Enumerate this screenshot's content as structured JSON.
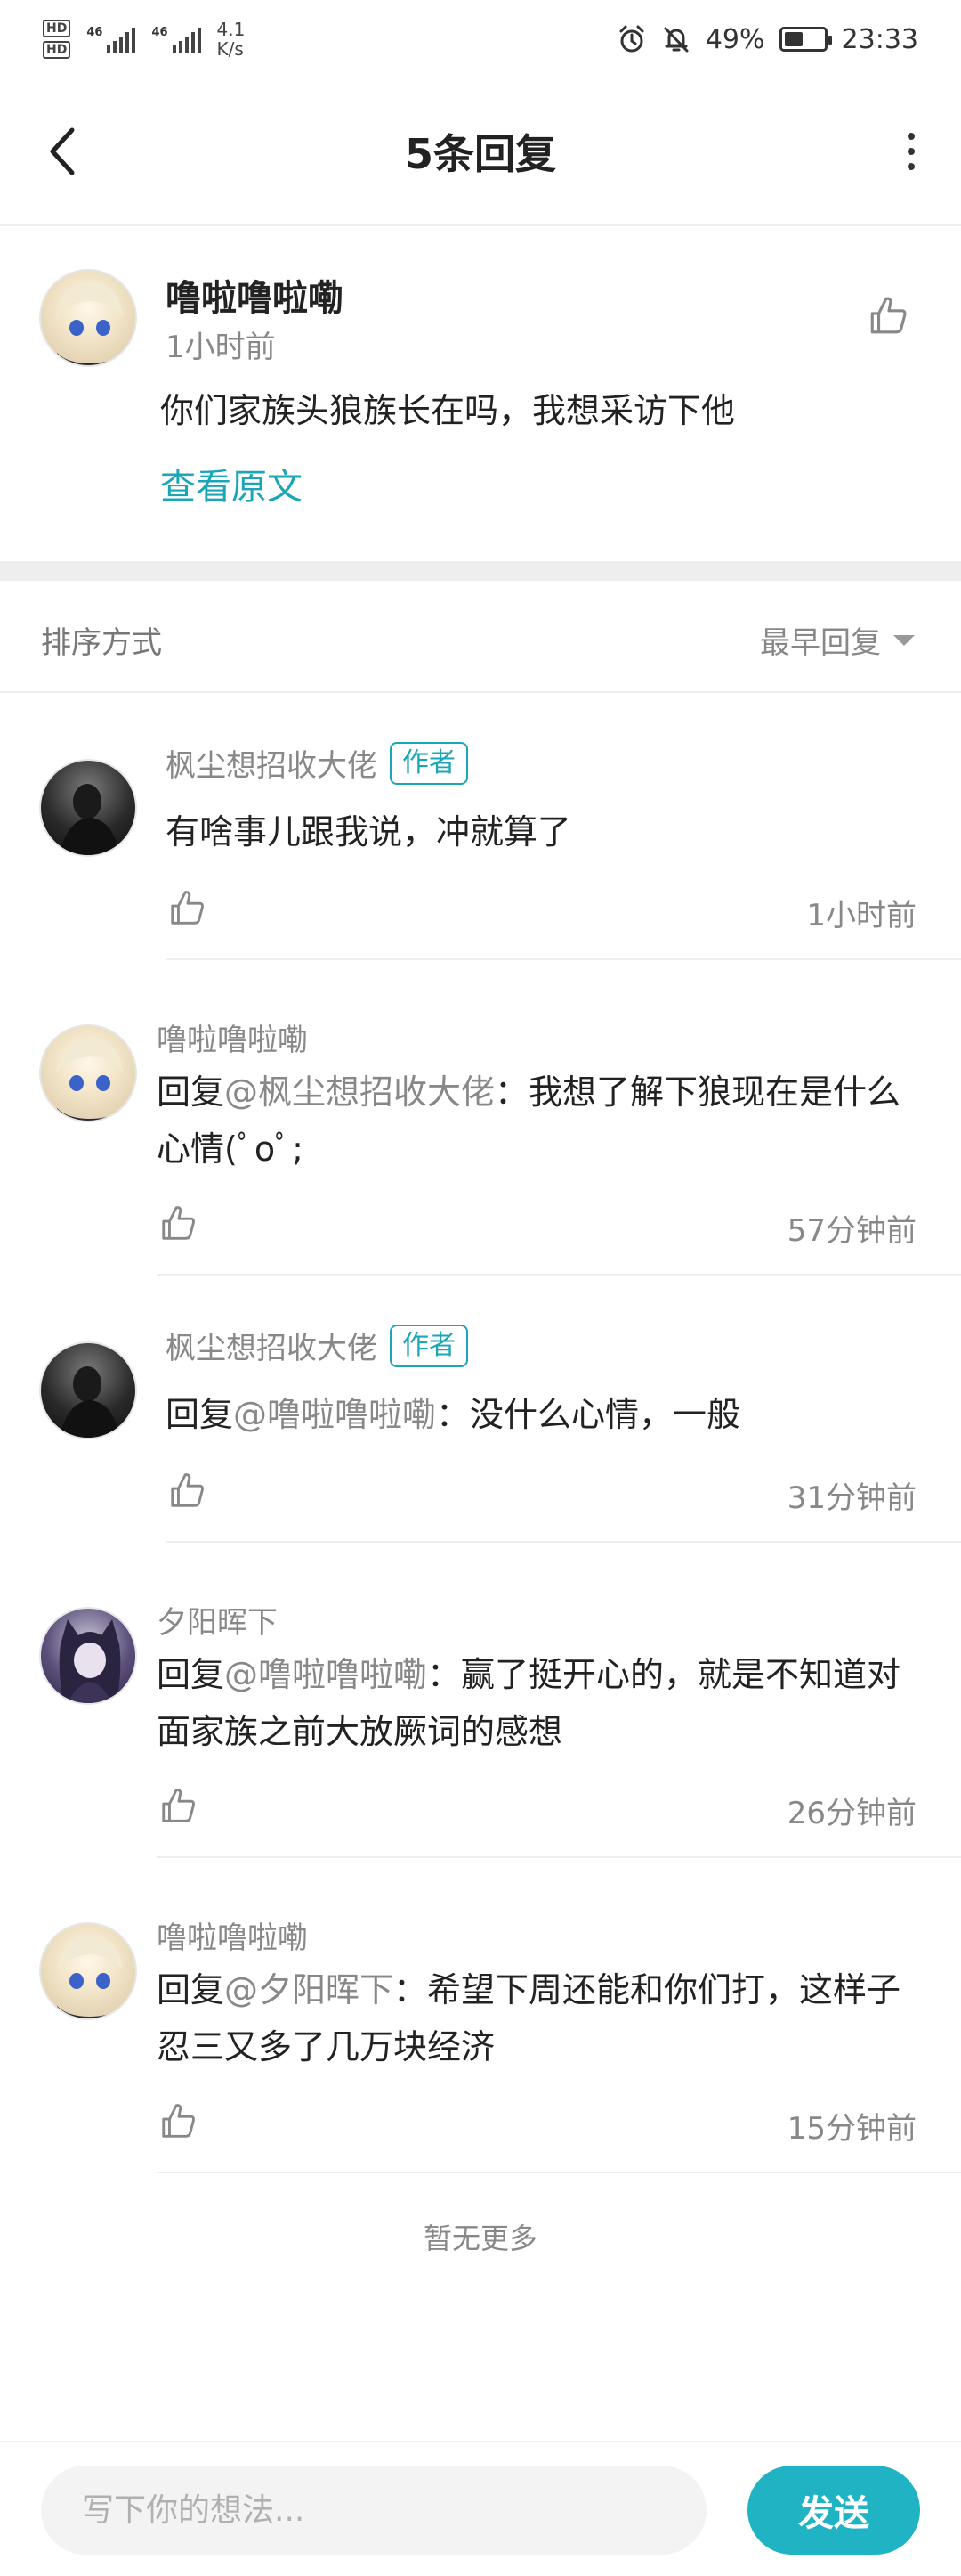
{
  "status_bar": {
    "hd1": "HD",
    "hd2": "HD",
    "sim1": "46",
    "sim2": "46",
    "speed_value": "4.1",
    "speed_unit": "K/s",
    "battery_percent": "49%",
    "battery_level": 0.49,
    "time": "23:33",
    "icons": [
      "alarm-icon",
      "mute-icon",
      "battery-icon"
    ]
  },
  "header": {
    "title": "5条回复",
    "back_icon": "chevron-left-icon",
    "more_icon": "more-vertical-icon"
  },
  "post": {
    "author": "噜啦噜啦嘞",
    "time": "1小时前",
    "text": "你们家族头狼族长在吗，我想采访下他",
    "view_original": "查看原文"
  },
  "sort": {
    "label": "排序方式",
    "selected": "最早回复"
  },
  "replies": [
    {
      "name": "枫尘想招收大佬",
      "tag": "作者",
      "prefix": "",
      "mention": "",
      "text": "有啥事儿跟我说，冲就算了",
      "time": "1小时前"
    },
    {
      "name": "噜啦噜啦嘞",
      "tag": "",
      "prefix": "回复",
      "mention": "@枫尘想招收大佬",
      "text": "：我想了解下狼现在是什么心情(ﾟoﾟ;",
      "time": "57分钟前"
    },
    {
      "name": "枫尘想招收大佬",
      "tag": "作者",
      "prefix": "回复",
      "mention": "@噜啦噜啦嘞",
      "text": "：没什么心情，一般",
      "time": "31分钟前"
    },
    {
      "name": "夕阳晖下",
      "tag": "",
      "prefix": "回复",
      "mention": "@噜啦噜啦嘞",
      "text": "：赢了挺开心的，就是不知道对面家族之前大放厥词的感想",
      "time": "26分钟前"
    },
    {
      "name": "噜啦噜啦嘞",
      "tag": "",
      "prefix": "回复",
      "mention": "@夕阳晖下",
      "text": "：希望下周还能和你们打，这样子忍三又多了几万块经济",
      "time": "15分钟前"
    }
  ],
  "footer": {
    "no_more": "暂无更多"
  },
  "input_bar": {
    "placeholder": "写下你的想法...",
    "send_label": "发送"
  },
  "colors": {
    "accent": "#1aa6b7",
    "send_button": "#1fb3c4",
    "muted_text": "#888888",
    "divider": "#eeeeee"
  }
}
